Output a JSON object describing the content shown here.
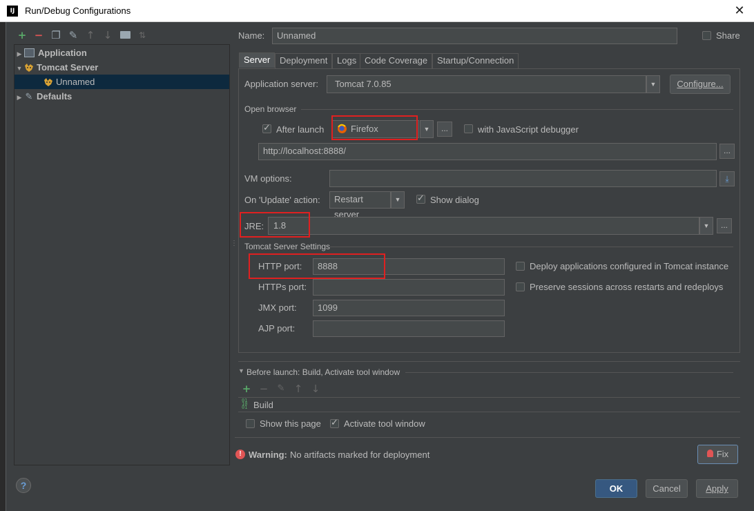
{
  "window": {
    "title": "Run/Debug Configurations",
    "app_icon_text": "IJ"
  },
  "tree": {
    "items": [
      {
        "label": "Application"
      },
      {
        "label": "Tomcat Server"
      },
      {
        "label": "Unnamed"
      },
      {
        "label": "Defaults"
      }
    ]
  },
  "name": {
    "label": "Name:",
    "value": "Unnamed"
  },
  "share": {
    "label": "Share",
    "checked": false
  },
  "tabs": [
    {
      "label": "Server",
      "active": true
    },
    {
      "label": "Deployment"
    },
    {
      "label": "Logs"
    },
    {
      "label": "Code Coverage"
    },
    {
      "label": "Startup/Connection"
    }
  ],
  "server": {
    "app_server_label": "Application server:",
    "app_server_value": "Tomcat 7.0.85",
    "configure_label": "Configure...",
    "open_browser_label": "Open browser",
    "after_launch_label": "After launch",
    "after_launch_checked": true,
    "browser_value": "Firefox",
    "dots_label": "...",
    "js_debugger_label": "with JavaScript debugger",
    "url_value": "http://localhost:8888/",
    "vm_options_label": "VM options:",
    "vm_options_value": "",
    "on_update_label": "On 'Update' action:",
    "on_update_value": "Restart server",
    "show_dialog_label": "Show dialog",
    "show_dialog_checked": true,
    "jre_label": "JRE:",
    "jre_value": "1.8",
    "tomcat_settings_label": "Tomcat Server Settings",
    "http_port_label": "HTTP port:",
    "http_port_value": "8888",
    "https_port_label": "HTTPs port:",
    "https_port_value": "",
    "jmx_port_label": "JMX port:",
    "jmx_port_value": "1099",
    "ajp_port_label": "AJP port:",
    "ajp_port_value": "",
    "deploy_apps_label": "Deploy applications configured in Tomcat instance",
    "preserve_sessions_label": "Preserve sessions across restarts and redeploys"
  },
  "before_launch": {
    "header": "Before launch: Build, Activate tool window",
    "item": "Build",
    "show_page_label": "Show this page",
    "activate_tool_label": "Activate tool window",
    "activate_tool_checked": true
  },
  "warning": {
    "bold": "Warning:",
    "text": "No artifacts marked for deployment"
  },
  "buttons": {
    "fix": "Fix",
    "ok": "OK",
    "cancel": "Cancel",
    "apply": "Apply",
    "help": "?"
  },
  "colors": {
    "accent": "#365880",
    "highlight": "#e02020",
    "add": "#59a869",
    "remove": "#e05555"
  }
}
